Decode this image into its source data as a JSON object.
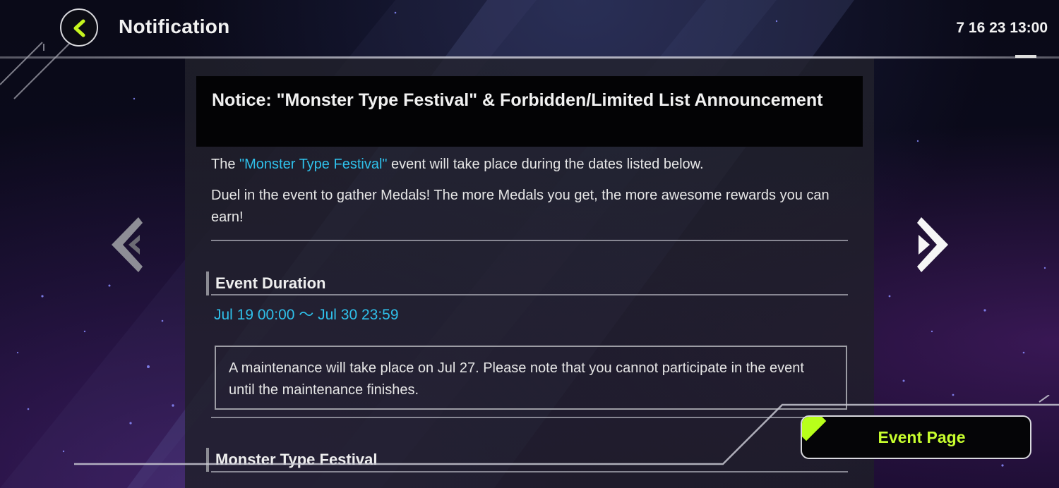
{
  "header": {
    "title": "Notification",
    "clock": "7 16 23 13:00"
  },
  "notice": {
    "title": "Notice:  \"Monster Type Festival\" & Forbidden/Limited List Announcement",
    "intro_prefix": "The ",
    "intro_highlight": "\"Monster Type Festival\"",
    "intro_suffix": " event will take place during the dates listed below.",
    "paragraph2": "Duel in the event to gather Medals! The more Medals you get, the more awesome rewards you can earn!",
    "section_duration_heading": "Event Duration",
    "duration": "Jul 19 00:00 ～ Jul 30 23:59",
    "maintenance_note": "A maintenance will take place on Jul 27. Please note that you cannot participate in the event until the maintenance finishes.",
    "section_festival_heading": "Monster Type Festival"
  },
  "footer": {
    "event_page_label": "Event Page"
  },
  "colors": {
    "accent_green": "#c8ff2e",
    "highlight_blue": "#2fc0ea",
    "back_chevron": "#c6f51f"
  },
  "icons": {
    "back": "chevron-left-icon",
    "prev": "double-chevron-left-icon",
    "next": "double-chevron-right-icon"
  }
}
